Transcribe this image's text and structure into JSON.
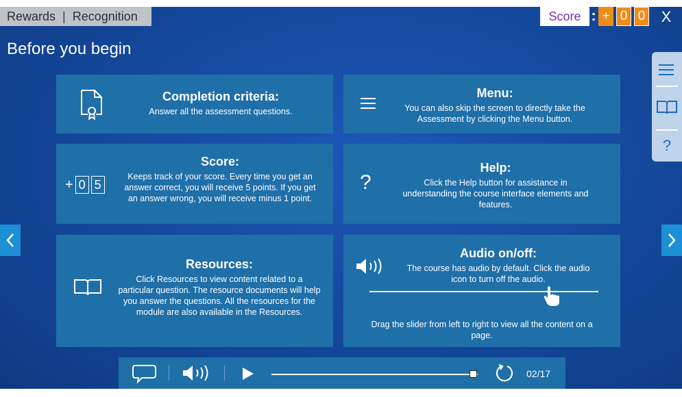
{
  "header": {
    "breadcrumb": [
      "Rewards",
      "Recognition"
    ],
    "breadcrumb_separator": "|",
    "score_label": "Score",
    "score_colon": ":",
    "score_digits": [
      "+",
      "0",
      "0"
    ],
    "close_label": "X"
  },
  "page_title": "Before you begin",
  "cards": {
    "completion": {
      "title": "Completion criteria:",
      "text": "Answer all the assessment questions."
    },
    "menu": {
      "title": "Menu:",
      "text": "You can also skip the screen to directly take the Assessment by clicking the Menu button."
    },
    "score": {
      "title": "Score:",
      "text": "Keeps track of your score. Every time you get an answer correct, you will receive 5 points. If you get an answer wrong, you will receive minus 1 point.",
      "sample_sign": "+",
      "sample_digits": [
        "0",
        "5"
      ]
    },
    "help": {
      "title": "Help:",
      "text": "Click the Help button for assistance in understanding the course interface elements and features.",
      "icon_glyph": "?"
    },
    "resources": {
      "title": "Resources:",
      "text": "Click Resources to view content related to a particular question. The resource documents will help you answer the questions. All the resources for the module are also available in the Resources."
    },
    "audio": {
      "title": "Audio on/off:",
      "text": "The course has audio by default. Click the audio icon to turn off the audio.",
      "slider_text": "Drag the slider from left to right to view all the content on a page.",
      "slider_level": 0.79
    }
  },
  "side_panel": {
    "items": [
      {
        "icon": "menu-icon"
      },
      {
        "icon": "book-icon"
      },
      {
        "icon": "help-icon",
        "glyph": "?"
      }
    ]
  },
  "player": {
    "progress": 0.98,
    "counter": "02/17"
  },
  "colors": {
    "background": "#154a9f",
    "card": "#1f6fa9",
    "accent_orange": "#ef8c1a",
    "score_text": "#7b2fb4",
    "nav_arrow": "#1c8fd6"
  }
}
